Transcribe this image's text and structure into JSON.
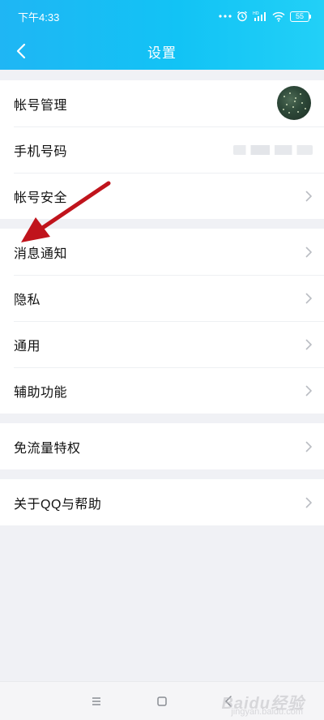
{
  "status_bar": {
    "time": "下午4:33",
    "battery": "55",
    "icons": [
      "dots-icon",
      "alarm-icon",
      "hd-signal-icon",
      "wifi-icon",
      "battery-icon"
    ]
  },
  "header": {
    "title": "设置",
    "back_icon": "chevron-left-icon",
    "gradient": [
      "#1fb6f4",
      "#22d0f7"
    ]
  },
  "groups": [
    {
      "items": [
        {
          "label": "帐号管理",
          "trailing": "avatar"
        },
        {
          "label": "手机号码",
          "trailing": "blurred-phone"
        },
        {
          "label": "帐号安全",
          "trailing": "chevron-right-icon"
        }
      ]
    },
    {
      "items": [
        {
          "label": "消息通知",
          "trailing": "chevron-right-icon"
        },
        {
          "label": "隐私",
          "trailing": "chevron-right-icon"
        },
        {
          "label": "通用",
          "trailing": "chevron-right-icon"
        },
        {
          "label": "辅助功能",
          "trailing": "chevron-right-icon"
        }
      ]
    },
    {
      "items": [
        {
          "label": "免流量特权",
          "trailing": "chevron-right-icon"
        }
      ]
    },
    {
      "items": [
        {
          "label": "关于QQ与帮助",
          "trailing": "chevron-right-icon"
        }
      ]
    }
  ],
  "annotation": {
    "icon": "red-arrow-icon",
    "color": "#c0141c"
  },
  "nav_bar": {
    "icons": [
      "menu-icon",
      "home-icon",
      "back-icon"
    ]
  },
  "watermark": {
    "text": "Baidu经验",
    "sub": "jingyan.baidu.com"
  }
}
